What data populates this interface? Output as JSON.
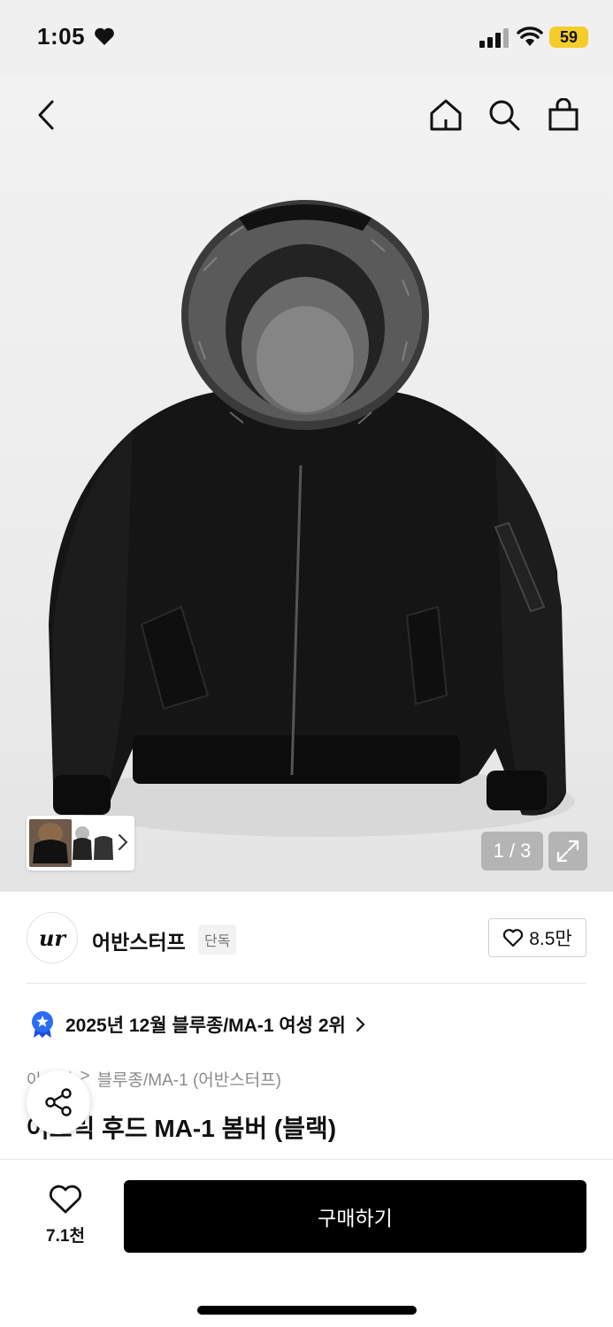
{
  "status_bar": {
    "time": "1:05",
    "battery": "59"
  },
  "gallery": {
    "counter": "1 / 3"
  },
  "brand": {
    "logo_text": "ur",
    "name": "어반스터프",
    "tag": "단독",
    "likes": "8.5만"
  },
  "ranking": {
    "text": "2025년 12월 블루종/MA-1 여성 2위"
  },
  "breadcrumb": {
    "category": "아우터",
    "separator": ">",
    "subcategory": "블루종/MA-1 (어반스터프)"
  },
  "product": {
    "title": "어드릭 후드 MA-1 봄버 (블랙)"
  },
  "bottom_bar": {
    "wish_count": "7.1천",
    "buy_label": "구매하기"
  },
  "colors": {
    "accent": "#000000",
    "badge_blue": "#2b6cf6",
    "battery": "#f4cd2a"
  }
}
